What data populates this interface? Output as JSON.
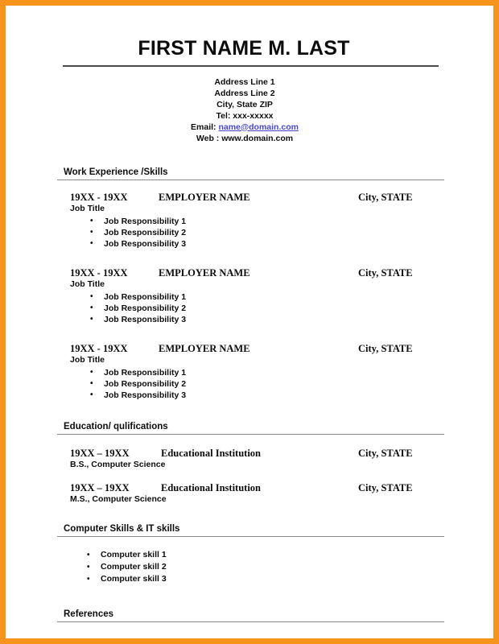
{
  "theme": {
    "border_color": "#f7941e",
    "page_color": "#ffffff",
    "text_color": "#0d0d0d",
    "rule_color": "#8a8a8a",
    "link_color": "#4646c8"
  },
  "header": {
    "name": "FIRST NAME M. LAST",
    "contact": {
      "address_line_1": "Address Line 1",
      "address_line_2": "Address Line 2",
      "city_state_zip": "City, State ZIP",
      "telephone": "Tel: xxx-xxxxx",
      "email_label": "Email:",
      "email_value": "name@domain.com",
      "web_label": "Web :",
      "web_value": "www.domain.com"
    }
  },
  "sections": {
    "work": {
      "heading": "Work Experience /Skills",
      "entries": [
        {
          "dates": "19XX - 19XX",
          "employer": "EMPLOYER NAME",
          "location": "City, STATE",
          "job_title": "Job Title",
          "responsibilities": [
            "Job Responsibility 1",
            "Job Responsibility 2",
            "Job Responsibility 3"
          ]
        },
        {
          "dates": "19XX - 19XX",
          "employer": "EMPLOYER NAME",
          "location": "City, STATE",
          "job_title": "Job Title",
          "responsibilities": [
            "Job Responsibility 1",
            "Job Responsibility 2",
            "Job Responsibility 3"
          ]
        },
        {
          "dates": "19XX - 19XX",
          "employer": "EMPLOYER NAME",
          "location": "City, STATE",
          "job_title": "Job Title",
          "responsibilities": [
            "Job Responsibility 1",
            "Job Responsibility 2",
            "Job Responsibility 3"
          ]
        }
      ]
    },
    "education": {
      "heading": "Education/ qulifications",
      "entries": [
        {
          "dates": "19XX – 19XX",
          "institution": "Educational Institution",
          "location": "City, STATE",
          "degree": "B.S., Computer Science"
        },
        {
          "dates": "19XX – 19XX",
          "institution": "Educational Institution",
          "location": "City, STATE",
          "degree": "M.S., Computer Science"
        }
      ]
    },
    "computer_skills": {
      "heading": "Computer Skills & IT skills",
      "items": [
        "Computer skill 1",
        "Computer skill 2",
        "Computer skill 3"
      ]
    },
    "references": {
      "heading": "References"
    }
  }
}
